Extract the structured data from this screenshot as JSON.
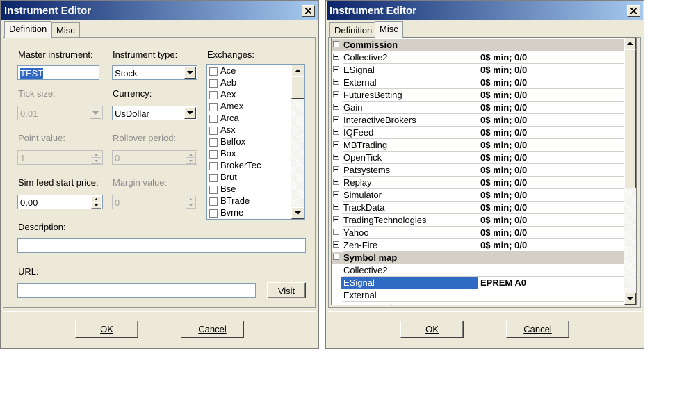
{
  "dialog_left": {
    "title": "Instrument Editor",
    "tabs": [
      "Definition",
      "Misc"
    ],
    "master_instrument": {
      "label": "Master instrument:",
      "value": "TEST"
    },
    "instrument_type": {
      "label": "Instrument type:",
      "value": "Stock"
    },
    "exchanges": {
      "label": "Exchanges:",
      "items": [
        "Ace",
        "Aeb",
        "Aex",
        "Amex",
        "Arca",
        "Asx",
        "Belfox",
        "Box",
        "BrokerTec",
        "Brut",
        "Bse",
        "BTrade",
        "Bvme"
      ]
    },
    "tick_size": {
      "label": "Tick size:",
      "value": "0.01"
    },
    "currency": {
      "label": "Currency:",
      "value": "UsDollar"
    },
    "point_value": {
      "label": "Point value:",
      "value": "1"
    },
    "rollover_period": {
      "label": "Rollover period:",
      "value": "0"
    },
    "sim_feed_start_price": {
      "label": "Sim feed start price:",
      "value": "0.00"
    },
    "margin_value": {
      "label": "Margin value:",
      "value": "0"
    },
    "description": {
      "label": "Description:",
      "value": ""
    },
    "url": {
      "label": "URL:",
      "value": ""
    },
    "visit_button": "Visit",
    "ok_button": "OK",
    "cancel_button": "Cancel"
  },
  "dialog_right": {
    "title": "Instrument Editor",
    "tabs": [
      "Definition",
      "Misc"
    ],
    "commission_category": "Commission",
    "commission_rows": [
      {
        "name": "Collective2",
        "value": "0$ min;  0/0"
      },
      {
        "name": "ESignal",
        "value": "0$ min;  0/0"
      },
      {
        "name": "External",
        "value": "0$ min;  0/0"
      },
      {
        "name": "FuturesBetting",
        "value": "0$ min;  0/0"
      },
      {
        "name": "Gain",
        "value": "0$ min;  0/0"
      },
      {
        "name": "InteractiveBrokers",
        "value": "0$ min;  0/0"
      },
      {
        "name": "IQFeed",
        "value": "0$ min;  0/0"
      },
      {
        "name": "MBTrading",
        "value": "0$ min;  0/0"
      },
      {
        "name": "OpenTick",
        "value": "0$ min;  0/0"
      },
      {
        "name": "Patsystems",
        "value": "0$ min;  0/0"
      },
      {
        "name": "Replay",
        "value": "0$ min;  0/0"
      },
      {
        "name": "Simulator",
        "value": "0$ min;  0/0"
      },
      {
        "name": "TrackData",
        "value": "0$ min;  0/0"
      },
      {
        "name": "TradingTechnologies",
        "value": "0$ min;  0/0"
      },
      {
        "name": "Yahoo",
        "value": "0$ min;  0/0"
      },
      {
        "name": "Zen-Fire",
        "value": "0$ min;  0/0"
      }
    ],
    "symbol_map_category": "Symbol map",
    "symbol_rows": [
      {
        "name": "Collective2",
        "value": ""
      },
      {
        "name": "ESignal",
        "value": "EPREM A0",
        "selected": true
      },
      {
        "name": "External",
        "value": ""
      },
      {
        "name": "FuturesBetting",
        "value": ""
      }
    ],
    "ok_button": "OK",
    "cancel_button": "Cancel"
  }
}
